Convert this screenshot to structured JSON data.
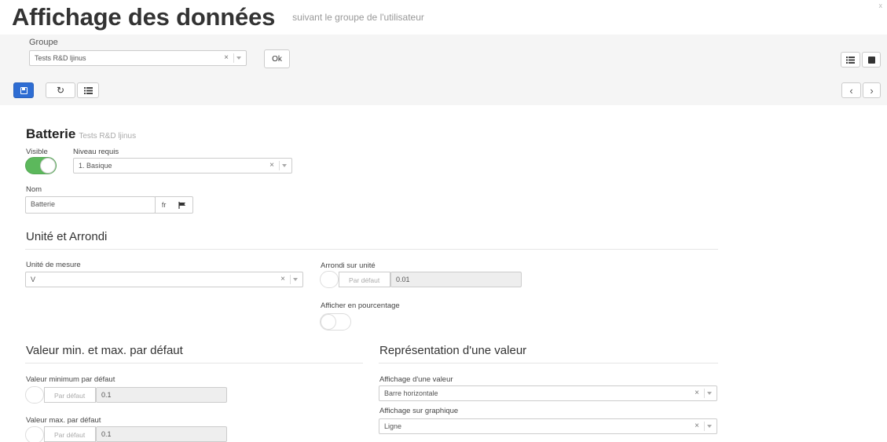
{
  "header": {
    "title": "Affichage des données",
    "subtitle": "suivant le groupe de l'utilisateur"
  },
  "toolbar": {
    "groupe_label": "Groupe",
    "groupe_value": "Tests R&D ljinus",
    "ok_label": "Ok"
  },
  "card": {
    "title": "Batterie",
    "subtitle": "Tests R&D ljinus",
    "visible_label": "Visible",
    "visible_on": true,
    "niveau_label": "Niveau requis",
    "niveau_value": "1. Basique",
    "nom_label": "Nom",
    "nom_value": "Batterie",
    "lang": "fr"
  },
  "unite": {
    "section_title": "Unité et Arrondi",
    "mesure_label": "Unité de mesure",
    "mesure_value": "V",
    "arrondi_label": "Arrondi sur unité",
    "arrondi_default_label": "Par défaut",
    "arrondi_value": "0.01",
    "pourcentage_label": "Afficher en pourcentage"
  },
  "minmax": {
    "section_title": "Valeur min. et max. par défaut",
    "min_label": "Valeur minimum par défaut",
    "min_default_label": "Par défaut",
    "min_value": "0.1",
    "max_label": "Valeur max. par défaut",
    "max_default_label": "Par défaut",
    "max_value": "0.1"
  },
  "representation": {
    "section_title": "Représentation d'une valeur",
    "affichage_label": "Affichage d'une valeur",
    "affichage_value": "Barre horizontale",
    "graphique_label": "Affichage sur graphique",
    "graphique_value": "Ligne"
  },
  "glyphs": {
    "close": "x",
    "clear": "×",
    "chevron_left": "‹",
    "chevron_right": "›",
    "refresh": "↻"
  },
  "colors": {
    "primary": "#2e6dd3",
    "toggle_on": "#5cb85c"
  }
}
